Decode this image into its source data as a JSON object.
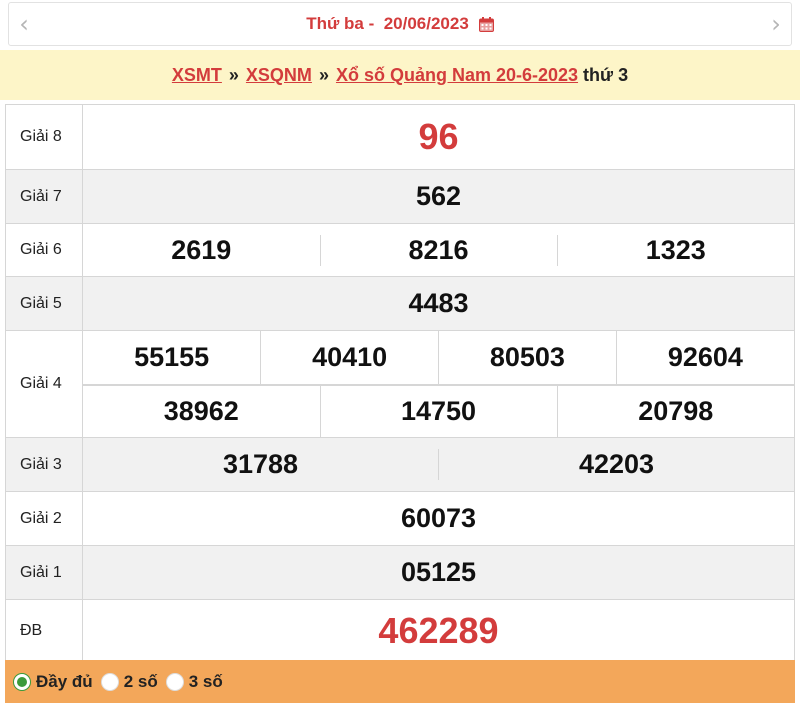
{
  "header": {
    "prev_icon": "chevron-left-icon",
    "next_icon": "chevron-right-icon",
    "date_label": "Thứ ba -  20/06/2023",
    "calendar_icon": "calendar-icon"
  },
  "breadcrumb": {
    "items": [
      "XSMT",
      "XSQNM",
      "Xổ số Quảng Nam 20-6-2023"
    ],
    "separator": "»",
    "tail": "thứ 3"
  },
  "prizes": {
    "g8": {
      "label": "Giải 8",
      "numbers": [
        "96"
      ]
    },
    "g7": {
      "label": "Giải 7",
      "numbers": [
        "562"
      ]
    },
    "g6": {
      "label": "Giải 6",
      "numbers": [
        "2619",
        "8216",
        "1323"
      ]
    },
    "g5": {
      "label": "Giải 5",
      "numbers": [
        "4483"
      ]
    },
    "g4": {
      "label": "Giải 4",
      "numbers": [
        "55155",
        "40410",
        "80503",
        "92604",
        "38962",
        "14750",
        "20798"
      ]
    },
    "g3": {
      "label": "Giải 3",
      "numbers": [
        "31788",
        "42203"
      ]
    },
    "g2": {
      "label": "Giải 2",
      "numbers": [
        "60073"
      ]
    },
    "g1": {
      "label": "Giải 1",
      "numbers": [
        "05125"
      ]
    },
    "db": {
      "label": "ĐB",
      "numbers": [
        "462289"
      ]
    }
  },
  "colors": {
    "accent_red": "#d33c3c",
    "breadcrumb_bg": "#fdf5c8",
    "footer_bg": "#f3a75a",
    "radio_checked": "#3b9a3b"
  },
  "footer": {
    "options": [
      {
        "label": "Đầy đủ",
        "checked": true
      },
      {
        "label": "2 số",
        "checked": false
      },
      {
        "label": "3 số",
        "checked": false
      }
    ]
  }
}
